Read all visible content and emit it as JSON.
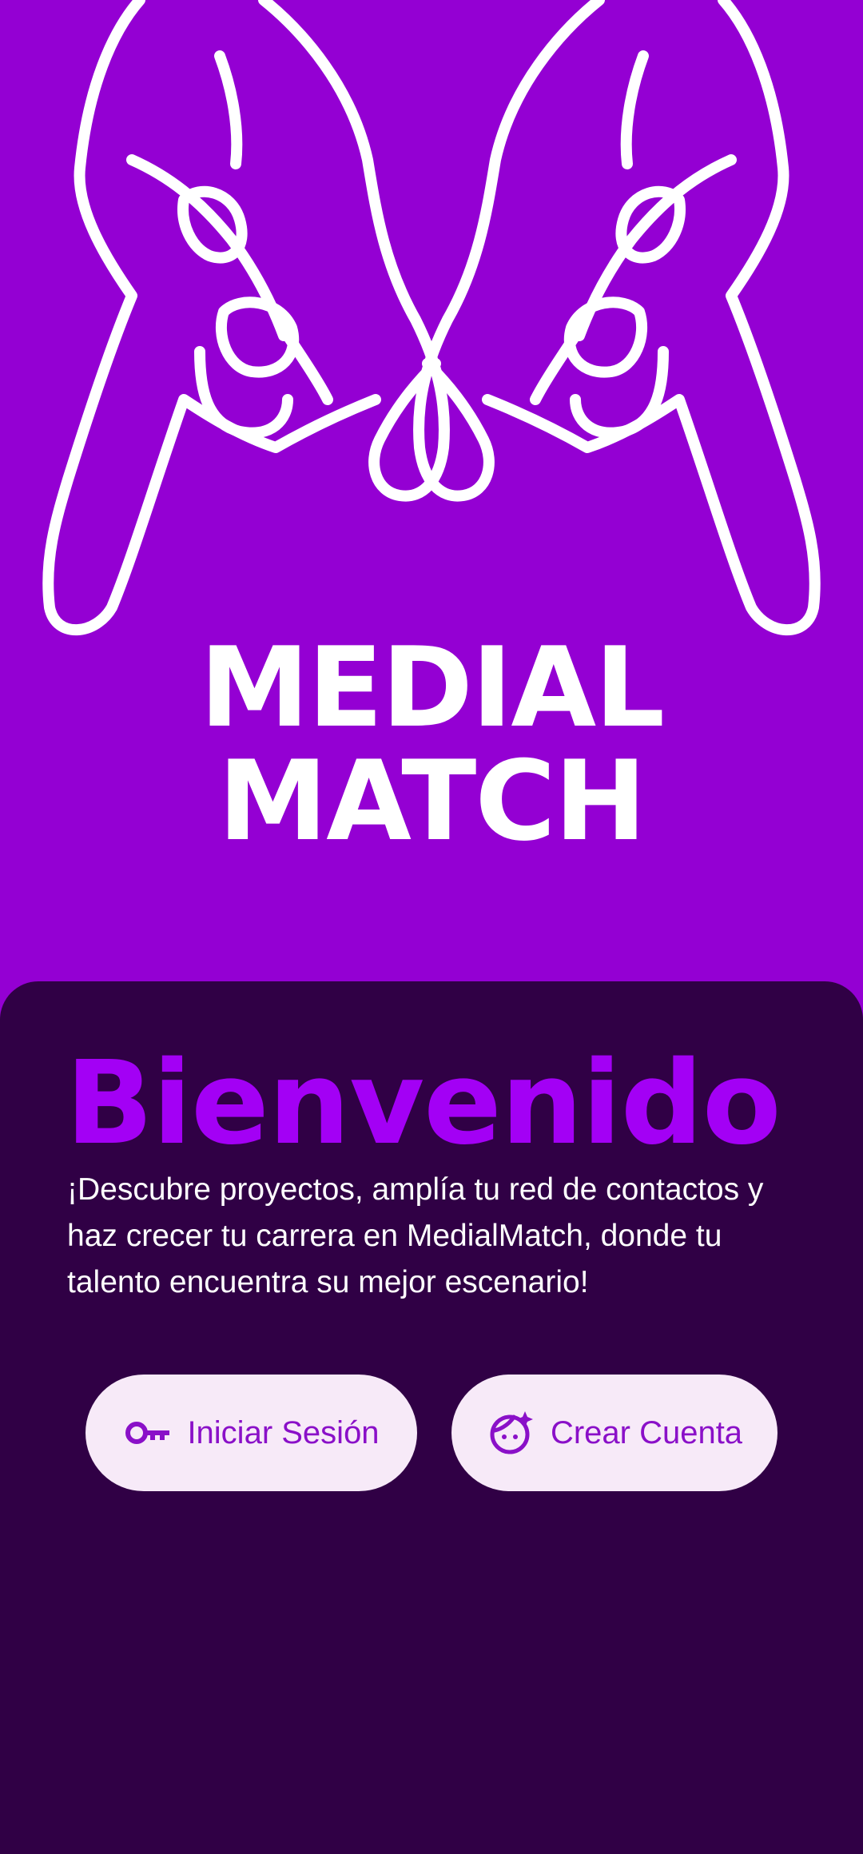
{
  "hero": {
    "illustration": "hands-forming-heart",
    "brand_line1": "MEDIAL",
    "brand_line2": "MATCH"
  },
  "welcome": {
    "title": "Bienvenido",
    "description": "¡Descubre proyectos, amplía tu red de contactos y haz crecer tu carrera en MedialMatch, donde tu talento encuentra su mejor escenario!"
  },
  "actions": {
    "login_label": "Iniciar Sesión",
    "login_icon": "key-icon",
    "signup_label": "Crear Cuenta",
    "signup_icon": "face-sparkle-icon"
  },
  "colors": {
    "hero_bg": "#9400D3",
    "panel_bg": "#300045",
    "accent": "#A300F5",
    "button_bg": "#F7EAF8",
    "button_text": "#8A10C8"
  }
}
